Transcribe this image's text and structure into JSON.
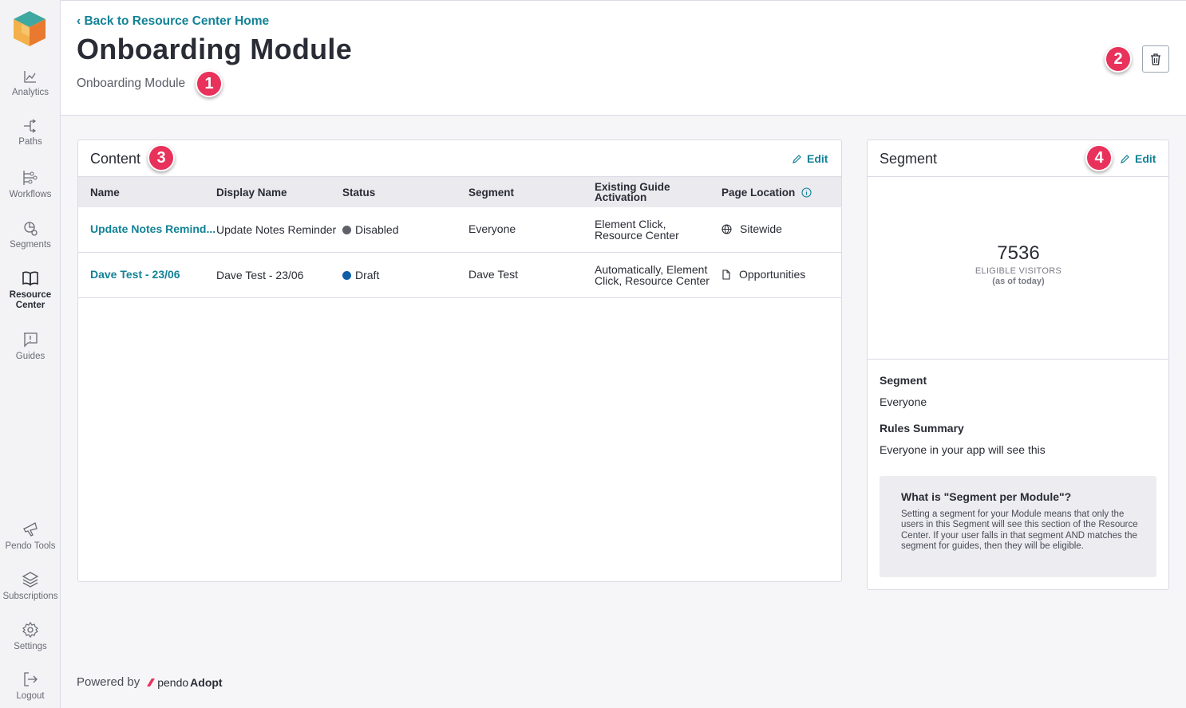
{
  "sidebar": {
    "items": [
      {
        "label": "Analytics",
        "icon": "chart-line-icon"
      },
      {
        "label": "Paths",
        "icon": "paths-icon"
      },
      {
        "label": "Workflows",
        "icon": "workflows-icon"
      },
      {
        "label": "Segments",
        "icon": "segments-icon"
      },
      {
        "label": "Resource Center",
        "icon": "book-open-icon"
      },
      {
        "label": "Guides",
        "icon": "guides-icon"
      },
      {
        "label": "Pendo Tools",
        "icon": "megaphone-icon"
      },
      {
        "label": "Subscriptions",
        "icon": "layers-icon"
      },
      {
        "label": "Settings",
        "icon": "gear-icon"
      },
      {
        "label": "Logout",
        "icon": "logout-icon"
      }
    ]
  },
  "header": {
    "back_link": "‹ Back to Resource Center Home",
    "title": "Onboarding Module",
    "subtitle": "Onboarding Module"
  },
  "badges": [
    "1",
    "2",
    "3",
    "4"
  ],
  "content_card": {
    "title": "Content",
    "edit_label": "Edit",
    "columns": [
      "Name",
      "Display Name",
      "Status",
      "Segment",
      "Existing Guide Activation",
      "Page Location"
    ],
    "rows": [
      {
        "name": "Update Notes Remind...",
        "display_name": "Update Notes Reminder",
        "status": "Disabled",
        "status_color": "#5f6068",
        "segment": "Everyone",
        "activation": "Element Click, Resource Center",
        "page_location": "Sitewide",
        "page_icon": "globe-icon"
      },
      {
        "name": "Dave Test - 23/06",
        "display_name": "Dave Test - 23/06",
        "status": "Draft",
        "status_color": "#0f5ea8",
        "segment": "Dave Test",
        "activation": "Automatically, Element Click, Resource Center",
        "page_location": "Opportunities",
        "page_icon": "page-icon"
      }
    ]
  },
  "segment_card": {
    "title": "Segment",
    "edit_label": "Edit",
    "visitor_count": "7536",
    "eligible_label": "ELIGIBLE VISITORS",
    "as_of_label": "(as of today)",
    "segment_label": "Segment",
    "segment_value": "Everyone",
    "rules_label": "Rules Summary",
    "rules_value": "Everyone in your app will see this",
    "info_title": "What is \"Segment per Module\"?",
    "info_text": "Setting a segment for your Module means that only the users in this Segment will see this section of the Resource Center. If your user falls in that segment AND matches the segment for guides, then they will be eligible."
  },
  "footer": {
    "powered_by": "Powered by",
    "brand": "pendo",
    "product": "Adopt"
  },
  "colors": {
    "accent": "#128297",
    "badge": "#e8315b"
  }
}
